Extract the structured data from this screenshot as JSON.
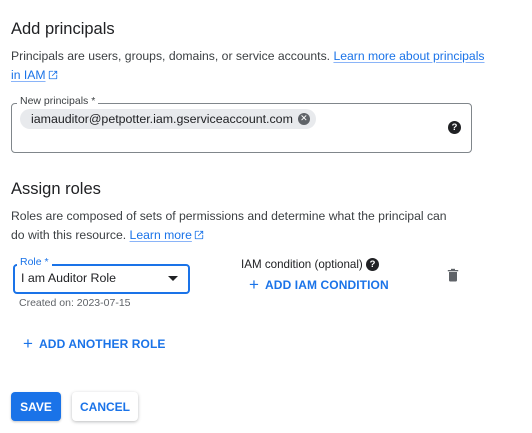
{
  "add_principals": {
    "title": "Add principals",
    "description": "Principals are users, groups, domains, or service accounts. ",
    "learn_more_link": "Learn more about principals in IAM",
    "field_label": "New principals *",
    "chips": [
      {
        "value": "iamauditor@petpotter.iam.gserviceaccount.com",
        "remove_icon": "cancel-circle-icon"
      }
    ],
    "help_icon": "help-circle-icon"
  },
  "assign_roles": {
    "title": "Assign roles",
    "description": "Roles are composed of sets of permissions and determine what the principal can do with this resource. ",
    "learn_more_link": "Learn more",
    "role_field": {
      "label": "Role *",
      "value": "I am Auditor Role",
      "created_on": "Created on: 2023-07-15"
    },
    "iam_condition": {
      "label": "IAM condition (optional)",
      "help_icon": "help-circle-icon",
      "add_button": "ADD IAM CONDITION"
    },
    "delete_icon": "trash-icon",
    "add_another_role": "ADD ANOTHER ROLE"
  },
  "actions": {
    "save": "SAVE",
    "cancel": "CANCEL"
  },
  "colors": {
    "primary": "#1a73e8",
    "text": "#202124",
    "secondary_text": "#5f6368",
    "chip_bg": "#e8eaed",
    "border": "#80868b"
  }
}
